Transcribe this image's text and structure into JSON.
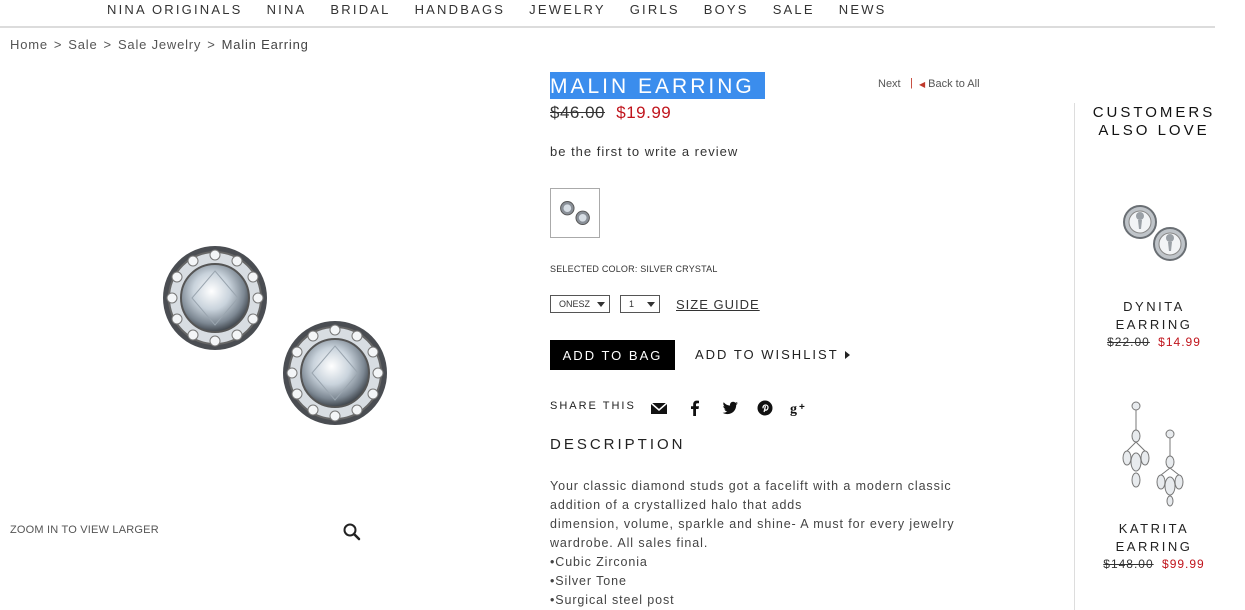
{
  "nav": {
    "items": [
      "NINA ORIGINALS",
      "NINA",
      "BRIDAL",
      "HANDBAGS",
      "JEWELRY",
      "GIRLS",
      "BOYS",
      "SALE",
      "NEWS"
    ]
  },
  "breadcrumb": {
    "items": [
      "Home",
      "Sale",
      "Sale Jewelry"
    ],
    "current": "Malin Earring",
    "separator": ">"
  },
  "image": {
    "zoom_label": "ZOOM IN TO VIEW LARGER"
  },
  "product": {
    "title": "MALIN EARRING",
    "next_label": "Next",
    "divider": "|",
    "back_label": "Back to All",
    "price_old": "$46.00",
    "price_new": "$19.99",
    "review_label": "be the first to write a review",
    "selected_color": "SELECTED COLOR: SILVER CRYSTAL",
    "size_value": "ONESZ",
    "qty_value": "1",
    "size_guide_label": "SIZE GUIDE",
    "add_to_bag_label": "ADD TO BAG",
    "wishlist_label": "ADD TO WISHLIST",
    "share_label": "SHARE THIS",
    "share_icons": [
      "envelope-icon",
      "facebook-icon",
      "twitter-icon",
      "pinterest-icon",
      "google-plus-icon"
    ],
    "description_heading": "DESCRIPTION",
    "description_lines": [
      "Your classic diamond studs got a facelift with a modern classic",
      "addition of a crystallized halo that adds",
      "dimension, volume, sparkle and shine- A must for every jewelry",
      "wardrobe. All sales final."
    ],
    "features": [
      "Cubic Zirconia",
      "Silver Tone",
      "Surgical steel post"
    ]
  },
  "sidebar": {
    "title_line1": "CUSTOMERS",
    "title_line2": "ALSO LOVE",
    "items": [
      {
        "name_line1": "DYNITA",
        "name_line2": "EARRING",
        "price_old": "$22.00",
        "price_new": "$14.99"
      },
      {
        "name_line1": "KATRITA",
        "name_line2": "EARRING",
        "price_old": "$148.00",
        "price_new": "$99.99"
      }
    ]
  },
  "colors": {
    "accent_red": "#c0141c",
    "title_highlight": "#3b8ded",
    "button_black": "#000000"
  }
}
